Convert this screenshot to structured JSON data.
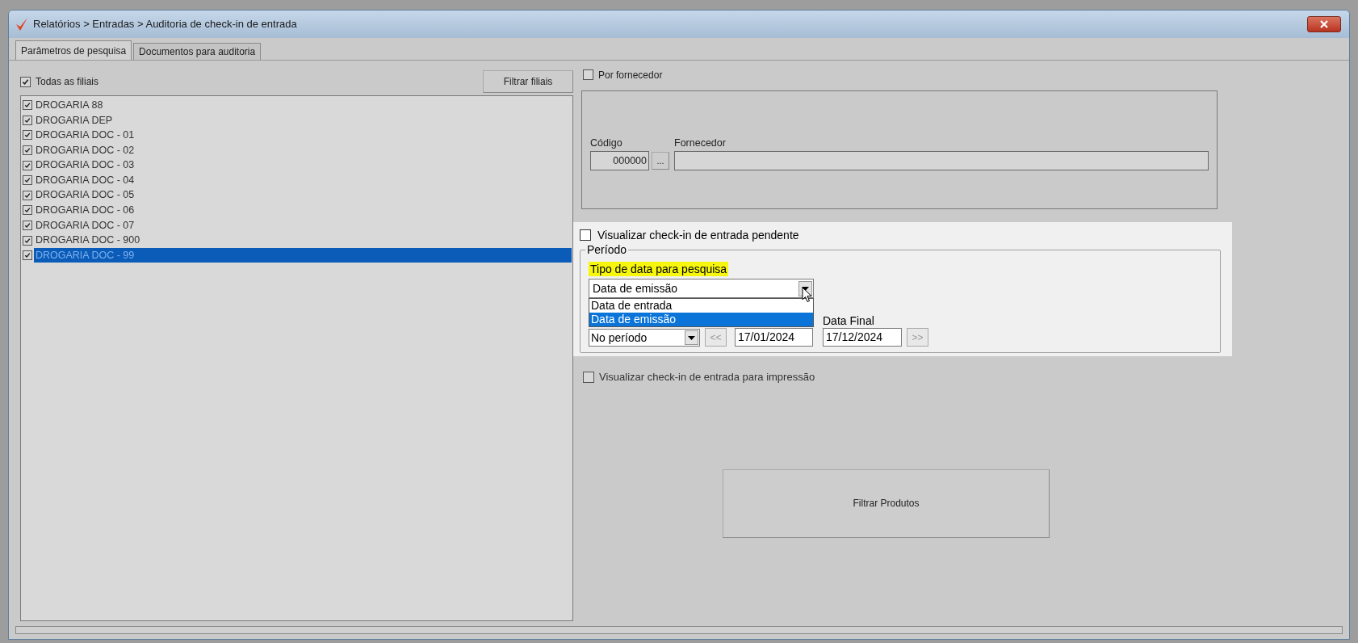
{
  "window": {
    "title": "Relatórios > Entradas > Auditoria de check-in de entrada"
  },
  "tabs": [
    {
      "label": "Parâmetros de pesquisa",
      "selected": true
    },
    {
      "label": "Documentos para auditoria",
      "selected": false
    }
  ],
  "branches": {
    "all_checkbox": {
      "label": "Todas as filiais",
      "checked": true
    },
    "filter_button": "Filtrar filiais",
    "items": [
      {
        "label": "DROGARIA 88",
        "checked": true,
        "selected": false
      },
      {
        "label": "DROGARIA DEP",
        "checked": true,
        "selected": false
      },
      {
        "label": "DROGARIA DOC - 01",
        "checked": true,
        "selected": false
      },
      {
        "label": "DROGARIA DOC - 02",
        "checked": true,
        "selected": false
      },
      {
        "label": "DROGARIA DOC - 03",
        "checked": true,
        "selected": false
      },
      {
        "label": "DROGARIA DOC - 04",
        "checked": true,
        "selected": false
      },
      {
        "label": "DROGARIA DOC - 05",
        "checked": true,
        "selected": false
      },
      {
        "label": "DROGARIA DOC - 06",
        "checked": true,
        "selected": false
      },
      {
        "label": "DROGARIA DOC - 07",
        "checked": true,
        "selected": false
      },
      {
        "label": "DROGARIA DOC - 900",
        "checked": true,
        "selected": false
      },
      {
        "label": "DROGARIA DOC - 99",
        "checked": true,
        "selected": true
      }
    ]
  },
  "supplier": {
    "checkbox": {
      "label": "Por fornecedor",
      "checked": false
    },
    "code_label": "Código",
    "code_value": "000000",
    "lookup_button": "...",
    "supplier_label": "Fornecedor"
  },
  "pending_checkbox": {
    "label": "Visualizar check-in de entrada pendente",
    "checked": false
  },
  "period": {
    "title": "Período",
    "date_type_label": "Tipo de data para pesquisa",
    "date_type_value": "Data de emissão",
    "date_type_options": [
      {
        "label": "Data de entrada",
        "selected": false
      },
      {
        "label": "Data de emissão",
        "selected": true
      }
    ],
    "range_value": "No período",
    "prev_button": "<<",
    "start_date": "17/01/2024",
    "end_label": "Data Final",
    "end_date": "17/12/2024",
    "next_button": ">>"
  },
  "print_checkbox": {
    "label": "Visualizar check-in de entrada para impressão",
    "checked": false
  },
  "filter_products_button": "Filtrar Produtos"
}
